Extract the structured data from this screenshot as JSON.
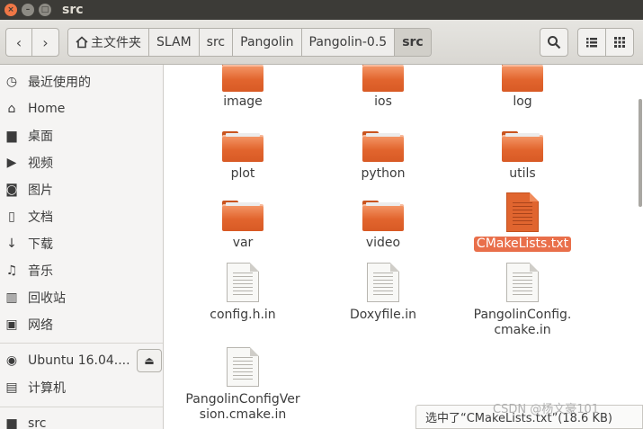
{
  "window": {
    "title": "src",
    "close_glyph": "×",
    "min_glyph": "–",
    "max_glyph": "□"
  },
  "toolbar": {
    "back_glyph": "‹",
    "forward_glyph": "›",
    "breadcrumbs": [
      {
        "label": "主文件夹",
        "icon": "home-icon"
      },
      {
        "label": "SLAM"
      },
      {
        "label": "src"
      },
      {
        "label": "Pangolin"
      },
      {
        "label": "Pangolin-0.5"
      },
      {
        "label": "src",
        "active": true
      }
    ],
    "search_icon": "search-icon",
    "list_view_icon": "list-icon",
    "grid_view_icon": "grid-icon"
  },
  "sidebar": {
    "items": [
      {
        "label": "最近使用的",
        "icon": "clock-icon",
        "glyph": "◷"
      },
      {
        "label": "Home",
        "icon": "home-icon",
        "glyph": "⌂"
      },
      {
        "label": "桌面",
        "icon": "folder-icon",
        "glyph": "▆"
      },
      {
        "label": "视频",
        "icon": "video-icon",
        "glyph": "▶"
      },
      {
        "label": "图片",
        "icon": "camera-icon",
        "glyph": "◙"
      },
      {
        "label": "文档",
        "icon": "document-icon",
        "glyph": "▯"
      },
      {
        "label": "下载",
        "icon": "download-icon",
        "glyph": "↓"
      },
      {
        "label": "音乐",
        "icon": "music-icon",
        "glyph": "♫"
      },
      {
        "label": "回收站",
        "icon": "trash-icon",
        "glyph": "▥"
      },
      {
        "label": "网络",
        "icon": "network-icon",
        "glyph": "▣"
      },
      {
        "label": "Ubuntu 16.04....",
        "icon": "disk-icon",
        "glyph": "◉"
      },
      {
        "label": "计算机",
        "icon": "computer-icon",
        "glyph": "▤"
      },
      {
        "label": "src",
        "icon": "folder-icon",
        "glyph": "▆"
      }
    ],
    "eject_glyph": "⏏"
  },
  "files": [
    {
      "name": "image",
      "type": "folder"
    },
    {
      "name": "ios",
      "type": "folder"
    },
    {
      "name": "log",
      "type": "folder"
    },
    {
      "name": "plot",
      "type": "folder"
    },
    {
      "name": "python",
      "type": "folder"
    },
    {
      "name": "utils",
      "type": "folder"
    },
    {
      "name": "var",
      "type": "folder"
    },
    {
      "name": "video",
      "type": "folder"
    },
    {
      "name": "CMakeLists.txt",
      "type": "text",
      "selected": true
    },
    {
      "name": "config.h.in",
      "type": "doc"
    },
    {
      "name": "Doxyfile.in",
      "type": "doc"
    },
    {
      "name": "PangolinConfig.",
      "name2": "cmake.in",
      "type": "doc"
    },
    {
      "name": "PangolinConfigVer",
      "name2": "sion.cmake.in",
      "type": "doc"
    }
  ],
  "status": {
    "text": "选中了“CMakeLists.txt”(18.6 KB)"
  },
  "watermark": "CSDN @杨文豪101",
  "colors": {
    "selection": "#e96f4a",
    "folder": "#e2652e",
    "titlebar": "#3c3b37"
  }
}
